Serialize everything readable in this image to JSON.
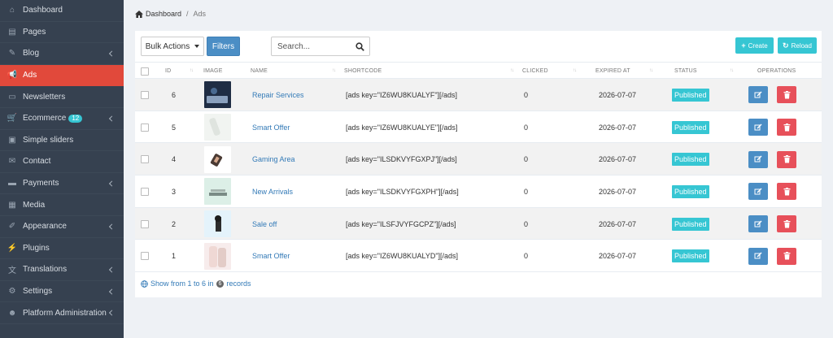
{
  "sidebar": {
    "items": [
      {
        "label": "Dashboard",
        "icon": "home-icon",
        "chevron": false,
        "active": false
      },
      {
        "label": "Pages",
        "icon": "book-icon",
        "chevron": false,
        "active": false
      },
      {
        "label": "Blog",
        "icon": "edit-icon",
        "chevron": true,
        "active": false
      },
      {
        "label": "Ads",
        "icon": "bullhorn-icon",
        "chevron": false,
        "active": true
      },
      {
        "label": "Newsletters",
        "icon": "newsletter-icon",
        "chevron": false,
        "active": false
      },
      {
        "label": "Ecommerce",
        "icon": "cart-icon",
        "chevron": true,
        "active": false,
        "badge": "12"
      },
      {
        "label": "Simple sliders",
        "icon": "image-icon",
        "chevron": false,
        "active": false
      },
      {
        "label": "Contact",
        "icon": "envelope-icon",
        "chevron": false,
        "active": false
      },
      {
        "label": "Payments",
        "icon": "card-icon",
        "chevron": true,
        "active": false
      },
      {
        "label": "Media",
        "icon": "media-icon",
        "chevron": false,
        "active": false
      },
      {
        "label": "Appearance",
        "icon": "brush-icon",
        "chevron": true,
        "active": false
      },
      {
        "label": "Plugins",
        "icon": "plug-icon",
        "chevron": false,
        "active": false
      },
      {
        "label": "Translations",
        "icon": "language-icon",
        "chevron": true,
        "active": false
      },
      {
        "label": "Settings",
        "icon": "cogs-icon",
        "chevron": true,
        "active": false
      },
      {
        "label": "Platform Administration",
        "icon": "user-shield-icon",
        "chevron": true,
        "active": false
      }
    ]
  },
  "breadcrumb": {
    "home": "Dashboard",
    "separator": "/",
    "current": "Ads"
  },
  "toolbar": {
    "bulk_label": "Bulk Actions",
    "filters_label": "Filters",
    "search_placeholder": "Search...",
    "create_label": "Create",
    "reload_label": "Reload"
  },
  "table": {
    "headers": {
      "id": "ID",
      "image": "IMAGE",
      "name": "NAME",
      "shortcode": "SHORTCODE",
      "clicked": "CLICKED",
      "expired": "EXPIRED AT",
      "status": "STATUS",
      "operations": "OPERATIONS"
    },
    "rows": [
      {
        "id": "6",
        "name": "Repair Services",
        "shortcode": "[ads key=\"IZ6WU8KUALYF\"][/ads]",
        "clicked": "0",
        "expired": "2026-07-07",
        "status": "Published",
        "thumb": "dark"
      },
      {
        "id": "5",
        "name": "Smart Offer",
        "shortcode": "[ads key=\"IZ6WU8KUALYE\"][/ads]",
        "clicked": "0",
        "expired": "2026-07-07",
        "status": "Published",
        "thumb": "light"
      },
      {
        "id": "4",
        "name": "Gaming Area",
        "shortcode": "[ads key=\"ILSDKVYFGXPJ\"][/ads]",
        "clicked": "0",
        "expired": "2026-07-07",
        "status": "Published",
        "thumb": "white"
      },
      {
        "id": "3",
        "name": "New Arrivals",
        "shortcode": "[ads key=\"ILSDKVYFGXPH\"][/ads]",
        "clicked": "0",
        "expired": "2026-07-07",
        "status": "Published",
        "thumb": "mint"
      },
      {
        "id": "2",
        "name": "Sale off",
        "shortcode": "[ads key=\"ILSFJVYFGCPZ\"][/ads]",
        "clicked": "0",
        "expired": "2026-07-07",
        "status": "Published",
        "thumb": "sky"
      },
      {
        "id": "1",
        "name": "Smart Offer",
        "shortcode": "[ads key=\"IZ6WU8KUALYD\"][/ads]",
        "clicked": "0",
        "expired": "2026-07-07",
        "status": "Published",
        "thumb": "pink"
      }
    ]
  },
  "footer": {
    "prefix": "Show from 1 to 6 in",
    "count": "6",
    "suffix": "records"
  },
  "colors": {
    "sidebar": "#364150",
    "active": "#e1493b",
    "info": "#36c6d3",
    "primary": "#4b8ec5",
    "danger": "#e7505a",
    "link": "#337ab7"
  }
}
